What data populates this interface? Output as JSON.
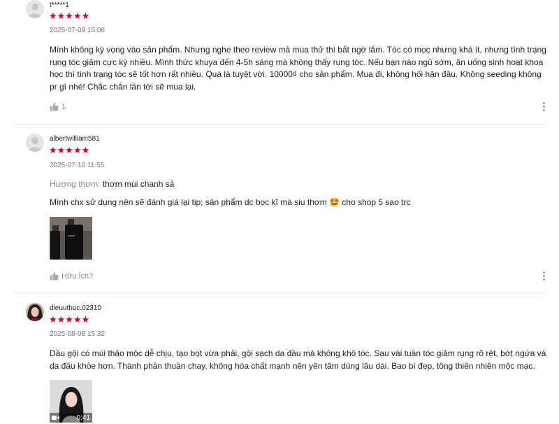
{
  "colors": {
    "star": "#d0011b",
    "muted": "#777777"
  },
  "reviews": [
    {
      "username": "t*****1",
      "stars": "★★★★★",
      "date": "2025-07-09 15:08",
      "text": "Mình không kỳ vọng vào sản phẩm. Nhưng nghe theo review mà mua thử thì bất ngờ lắm. Tóc có mọc nhưng khá ít, nhưng tình trạng rụng tóc giảm cực kỳ nhiều. Mình thức khuya đến 4-5h sáng mà không thấy rụng tóc. Nếu bạn nào ngủ sớm, ăn uống sinh hoạt khoa học thì tình trạng tóc sẽ tốt hơn rất nhiều. Quá là tuyệt vời. 10000₫ cho sản phẩm. Mua đi, không hối hận đâu. Không seeding không pr gì nhé! Chắc chắn lần tới sẽ mua lại.",
      "like_label": "1"
    },
    {
      "username": "albertwilliam581",
      "stars": "★★★★★",
      "date": "2025-07-10 11:55",
      "attr_key": "Hương thơm:",
      "attr_value": "thơm mùi chanh sả",
      "text": "Mình chx sử dụng nên sẽ đánh giá lại tip; sản phẩm dc bọc kĩ mà siu thơm 🤩 cho shop 5 sao trc",
      "like_label": "Hữu Ích?"
    },
    {
      "username": "dieuuthuc.02310",
      "stars": "★★★★★",
      "date": "2025-08-08 15:32",
      "text": "Dầu gội có mùi thảo mộc dễ chịu, tạo bọt vừa phải, gội sạch da đầu mà không khô tóc. Sau vài tuần tóc giảm rụng rõ rệt, bớt ngứa và da đầu khỏe hơn. Thành phần thuần chay, không hóa chất mạnh nên yên tâm dùng lâu dài. Bao bì đẹp, tông thiên nhiên mộc mạc.",
      "video_duration": "0:41"
    }
  ]
}
